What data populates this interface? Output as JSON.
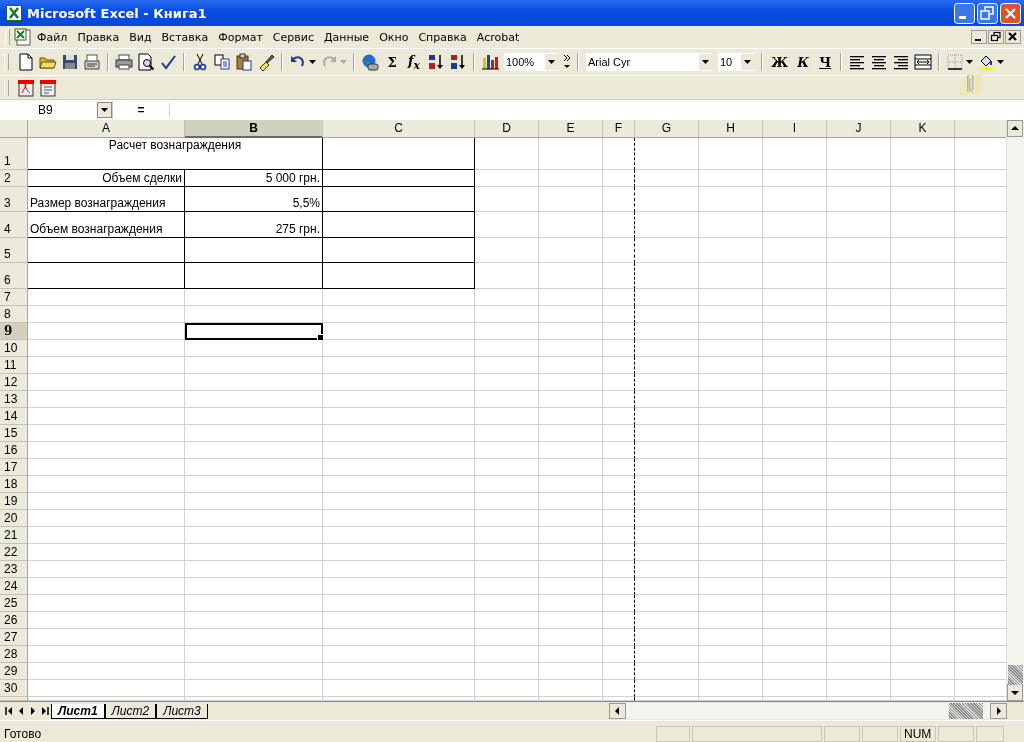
{
  "window": {
    "title": "Microsoft Excel - Книга1"
  },
  "menu": [
    "Файл",
    "Правка",
    "Вид",
    "Вставка",
    "Формат",
    "Сервис",
    "Данные",
    "Окно",
    "Справка",
    "Acrobat"
  ],
  "toolbar": {
    "sum": "Σ",
    "function": "f$_{x}$",
    "zoom": "100%",
    "font": "Arial Cyr",
    "font_size": "10",
    "bold": "Ж",
    "italic": "К",
    "underline": "Ч"
  },
  "formula_bar": {
    "name_box": "B9",
    "equals": "="
  },
  "columns": [
    {
      "label": "A",
      "selected": false
    },
    {
      "label": "B",
      "selected": true
    },
    {
      "label": "C",
      "selected": false
    },
    {
      "label": "D",
      "selected": false
    },
    {
      "label": "E",
      "selected": false
    },
    {
      "label": "F",
      "selected": false
    },
    {
      "label": "G",
      "selected": false
    },
    {
      "label": "H",
      "selected": false
    },
    {
      "label": "I",
      "selected": false
    },
    {
      "label": "J",
      "selected": false
    },
    {
      "label": "K",
      "selected": false
    }
  ],
  "rows": [
    {
      "label": "1",
      "selected": false,
      "cells": [
        {
          "kind": "title",
          "text": "Расчет вознаграждения",
          "merged": true,
          "bordered": true,
          "active": false
        },
        {
          "merged": false,
          "bordered": true,
          "active": false
        }
      ]
    },
    {
      "label": "2",
      "selected": false,
      "cells": [
        {
          "kind": "caption",
          "text": "Объем сделки",
          "merged": false,
          "bordered": true,
          "active": false
        },
        {
          "kind": "value",
          "text": "5 000 грн.",
          "merged": false,
          "bordered": true,
          "active": false
        },
        {
          "merged": false,
          "bordered": true,
          "active": false
        }
      ]
    },
    {
      "label": "3",
      "selected": false,
      "cells": [
        {
          "kind": "label",
          "text": "Размер вознаграждения",
          "merged": false,
          "bordered": true,
          "active": false
        },
        {
          "kind": "value",
          "text": "5,5%",
          "merged": false,
          "bordered": true,
          "active": false
        },
        {
          "merged": false,
          "bordered": true,
          "active": false
        }
      ]
    },
    {
      "label": "4",
      "selected": false,
      "cells": [
        {
          "kind": "label",
          "text": "Объем вознаграждения",
          "merged": false,
          "bordered": true,
          "active": false
        },
        {
          "kind": "value",
          "text": "275 грн.",
          "merged": false,
          "bordered": true,
          "active": false
        },
        {
          "merged": false,
          "bordered": true,
          "active": false
        }
      ]
    },
    {
      "label": "5",
      "selected": false,
      "cells": [
        {
          "merged": false,
          "bordered": true,
          "active": false
        },
        {
          "merged": false,
          "bordered": true,
          "active": false
        },
        {
          "merged": false,
          "bordered": true,
          "active": false
        }
      ]
    },
    {
      "label": "6",
      "selected": false,
      "cells": [
        {
          "merged": false,
          "bordered": true,
          "active": false
        },
        {
          "merged": false,
          "bordered": true,
          "active": false
        },
        {
          "merged": false,
          "bordered": true,
          "active": false
        }
      ]
    },
    {
      "label": "7",
      "selected": false
    },
    {
      "label": "8",
      "selected": false
    },
    {
      "label": "9",
      "selected": true,
      "cells": [
        {
          "merged": false,
          "bordered": false,
          "active": false
        },
        {
          "merged": false,
          "bordered": false,
          "active": true
        }
      ]
    },
    {
      "label": "10",
      "selected": false
    },
    {
      "label": "11",
      "selected": false
    },
    {
      "label": "12",
      "selected": false
    },
    {
      "label": "13",
      "selected": false
    },
    {
      "label": "14",
      "selected": false
    },
    {
      "label": "15",
      "selected": false
    },
    {
      "label": "16",
      "selected": false
    },
    {
      "label": "17",
      "selected": false
    },
    {
      "label": "18",
      "selected": false
    },
    {
      "label": "19",
      "selected": false
    },
    {
      "label": "20",
      "selected": false
    },
    {
      "label": "21",
      "selected": false
    },
    {
      "label": "22",
      "selected": false
    },
    {
      "label": "23",
      "selected": false
    },
    {
      "label": "24",
      "selected": false
    },
    {
      "label": "25",
      "selected": false
    },
    {
      "label": "26",
      "selected": false
    },
    {
      "label": "27",
      "selected": false
    },
    {
      "label": "28",
      "selected": false
    },
    {
      "label": "29",
      "selected": false
    },
    {
      "label": "30",
      "selected": false
    }
  ],
  "sheets": [
    {
      "label": "Лист1",
      "selected": true
    },
    {
      "label": "Лист2",
      "selected": false
    },
    {
      "label": "Лист3",
      "selected": false
    }
  ],
  "status_bar": {
    "text": "Готово",
    "indicators": [
      "NUM"
    ]
  }
}
